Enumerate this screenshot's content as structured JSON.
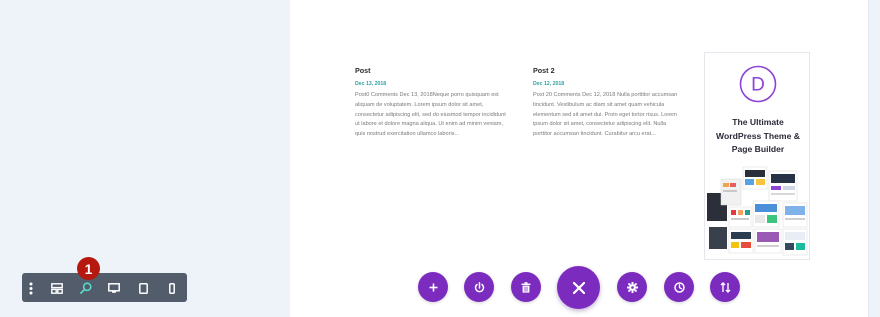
{
  "colors": {
    "background": "#eef2f9",
    "canvas": "#ffffff",
    "date_accent": "#2ea3a5",
    "toolbar": "#525c6b",
    "active_view": "#59d9c9",
    "action_purple": "#7b2cbf",
    "badge_red": "#b5180f",
    "divi_purple": "#8e44d6"
  },
  "posts": [
    {
      "title": "Post",
      "date": "Dec 13, 2018",
      "excerpt": "Post0 Comments Dec 13, 2018Neque porro quisquam est aliquam de voluptatem. Lorem ipsum dolor sit amet, consectetur adipiscing elit, sed do eiusmod tempor incididunt ut labore et dolore magna aliqua. Ut enim ad minim veniam, quis nostrud exercitation ullamco laboris..."
    },
    {
      "title": "Post 2",
      "date": "Dec 12, 2018",
      "excerpt": "Post 20 Comments Dec 12, 2018 Nulla porttitor accumsan tincidunt. Vestibulum ac diam sit amet quam vehicula elementum sed sit amet dui. Proin eget tortor risus. Lorem ipsum dolor sit amet, consectetur adipiscing elit. Nulla porttitor accumsan tincidunt. Curabitur arcu erat..."
    }
  ],
  "ad": {
    "logo_letter": "D",
    "heading": "The Ultimate WordPress Theme & Page Builder"
  },
  "toolbar": {
    "buttons": [
      {
        "icon": "more-vertical-icon"
      },
      {
        "icon": "wireframe-view-icon"
      },
      {
        "icon": "zoom-icon",
        "active": true
      },
      {
        "icon": "desktop-view-icon"
      },
      {
        "icon": "tablet-view-icon"
      },
      {
        "icon": "phone-view-icon"
      }
    ],
    "badge": "1"
  },
  "actions": [
    {
      "icon": "add-icon"
    },
    {
      "icon": "portability-icon"
    },
    {
      "icon": "trash-icon"
    },
    {
      "icon": "close-icon"
    },
    {
      "icon": "settings-icon"
    },
    {
      "icon": "history-icon"
    },
    {
      "icon": "sort-icon"
    }
  ]
}
